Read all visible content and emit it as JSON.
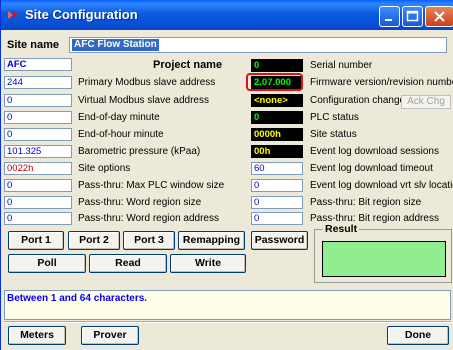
{
  "window": {
    "title": "Site Configuration"
  },
  "site": {
    "label": "Site name",
    "value": "AFC Flow Station"
  },
  "left": {
    "project": {
      "value": "AFC",
      "label": "Project name"
    },
    "rows": [
      {
        "value": "244",
        "label": "Primary Modbus slave address"
      },
      {
        "value": "0",
        "label": "Virtual Modbus slave address"
      },
      {
        "value": "0",
        "label": "End-of-day minute"
      },
      {
        "value": "0",
        "label": "End-of-hour minute"
      },
      {
        "value": "101.325",
        "label": "Barometric pressure (kPaa)"
      },
      {
        "value": "0022h",
        "label": "Site options"
      },
      {
        "value": "0",
        "label": "Pass-thru: Max PLC window size"
      },
      {
        "value": "0",
        "label": "Pass-thru: Word region size"
      },
      {
        "value": "0",
        "label": "Pass-thru: Word region address"
      }
    ]
  },
  "right": {
    "rows": [
      {
        "value": "0",
        "label": "Serial number"
      },
      {
        "value": "2.07.000",
        "label": "Firmware version/revision number"
      },
      {
        "value": "<none>",
        "label": "Configuration changed"
      },
      {
        "value": "0",
        "label": "PLC status"
      },
      {
        "value": "0000h",
        "label": "Site status"
      },
      {
        "value": "00h",
        "label": "Event log download sessions"
      },
      {
        "value": "60",
        "label": "Event log download timeout"
      },
      {
        "value": "0",
        "label": "Event log download vrt slv location"
      },
      {
        "value": "0",
        "label": "Pass-thru: Bit region size"
      },
      {
        "value": "0",
        "label": "Pass-thru: Bit region address"
      }
    ],
    "ack_button": "Ack Chg"
  },
  "buttons": {
    "port1": "Port 1",
    "port2": "Port 2",
    "port3": "Port 3",
    "remapping": "Remapping",
    "password": "Password",
    "poll": "Poll",
    "read": "Read",
    "write": "Write",
    "meters": "Meters",
    "prover": "Prover",
    "done": "Done"
  },
  "result": {
    "label": "Result"
  },
  "message": "Between 1 and 64 characters.",
  "colors": {
    "accent": "#0a5bdc",
    "result_fill": "#90ee90",
    "message_text": "#0000ff",
    "highlight": "#e01010"
  }
}
